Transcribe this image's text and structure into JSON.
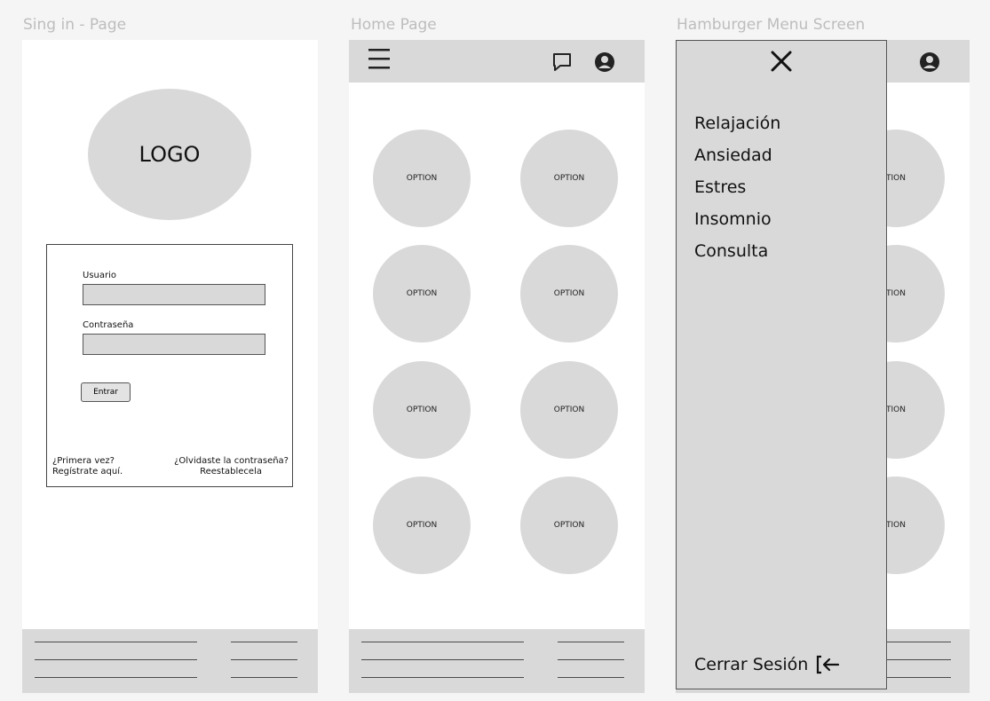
{
  "screens": {
    "signin": {
      "title": "Sing in - Page"
    },
    "home": {
      "title": "Home Page"
    },
    "menu": {
      "title": "Hamburger Menu Screen"
    }
  },
  "signin": {
    "logo_text": "LOGO",
    "username_label": "Usuario",
    "username_value": "",
    "password_label": "Contraseña",
    "password_value": "",
    "submit_label": "Entrar",
    "first_time_line1": "¿Primera vez?",
    "first_time_line2": "Regístrate aquí.",
    "forgot_line1": "¿Olvidaste la contraseña?",
    "forgot_line2": "Reestablecela"
  },
  "home": {
    "options": [
      "OPTION",
      "OPTION",
      "OPTION",
      "OPTION",
      "OPTION",
      "OPTION",
      "OPTION",
      "OPTION"
    ],
    "icons": {
      "menu": "hamburger-icon",
      "chat": "chat-icon",
      "profile": "profile-icon"
    }
  },
  "menu": {
    "items": [
      "Relajación",
      "Ansiedad",
      "Estres",
      "Insomnio",
      "Consulta"
    ],
    "logout_label": "Cerrar Sesión",
    "close_icon": "close-icon",
    "logout_icon": "logout-icon",
    "background_option_fragment": "TION"
  },
  "colors": {
    "placeholder_grey": "#d9d9d9",
    "frame_white": "#ffffff",
    "canvas": "#f5f5f5"
  }
}
